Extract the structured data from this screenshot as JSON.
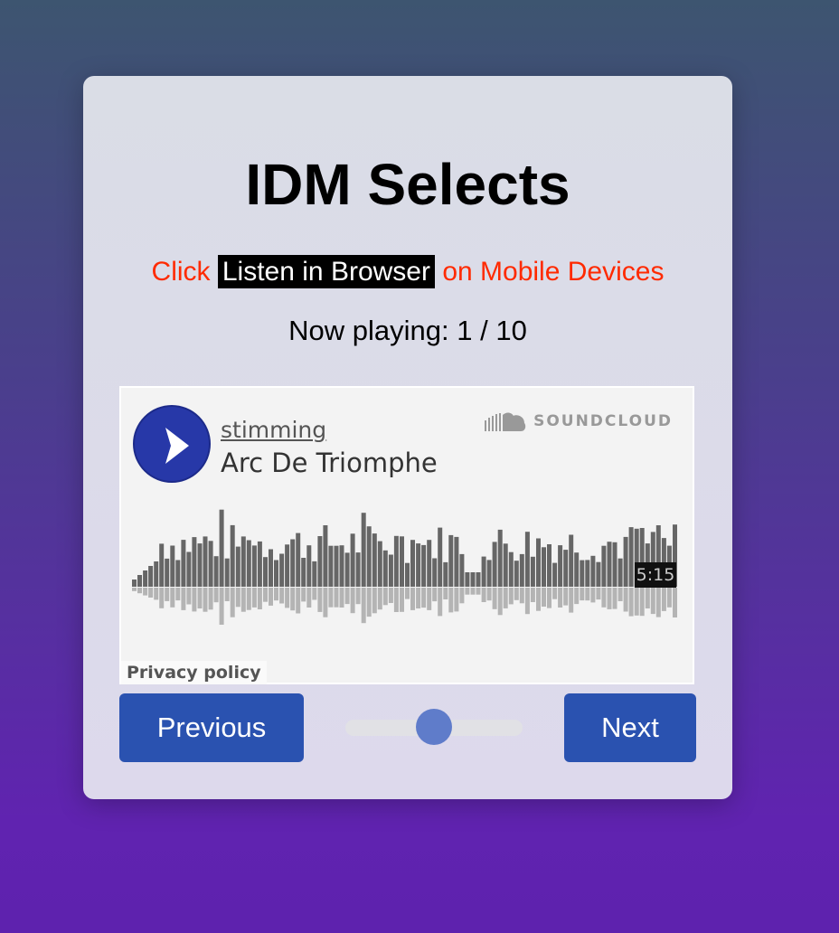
{
  "title": "IDM Selects",
  "hint": {
    "prefix": "Click",
    "highlight": "Listen in Browser",
    "suffix": "on Mobile Devices"
  },
  "now_playing": "Now playing: 1 / 10",
  "player": {
    "artist": "stimming",
    "track": "Arc De Triomphe",
    "brand": "SOUNDCLOUD",
    "duration": "5:15",
    "privacy": "Privacy policy",
    "play_icon": "play-icon",
    "brand_icon": "soundcloud-cloud-icon"
  },
  "controls": {
    "previous": "Previous",
    "next": "Next",
    "slider_level": 0.5
  },
  "colors": {
    "button": "#2a52b0",
    "hint_text": "#ff2a00",
    "play_button": "#2738a8",
    "slider_thumb": "#5f7cca"
  }
}
